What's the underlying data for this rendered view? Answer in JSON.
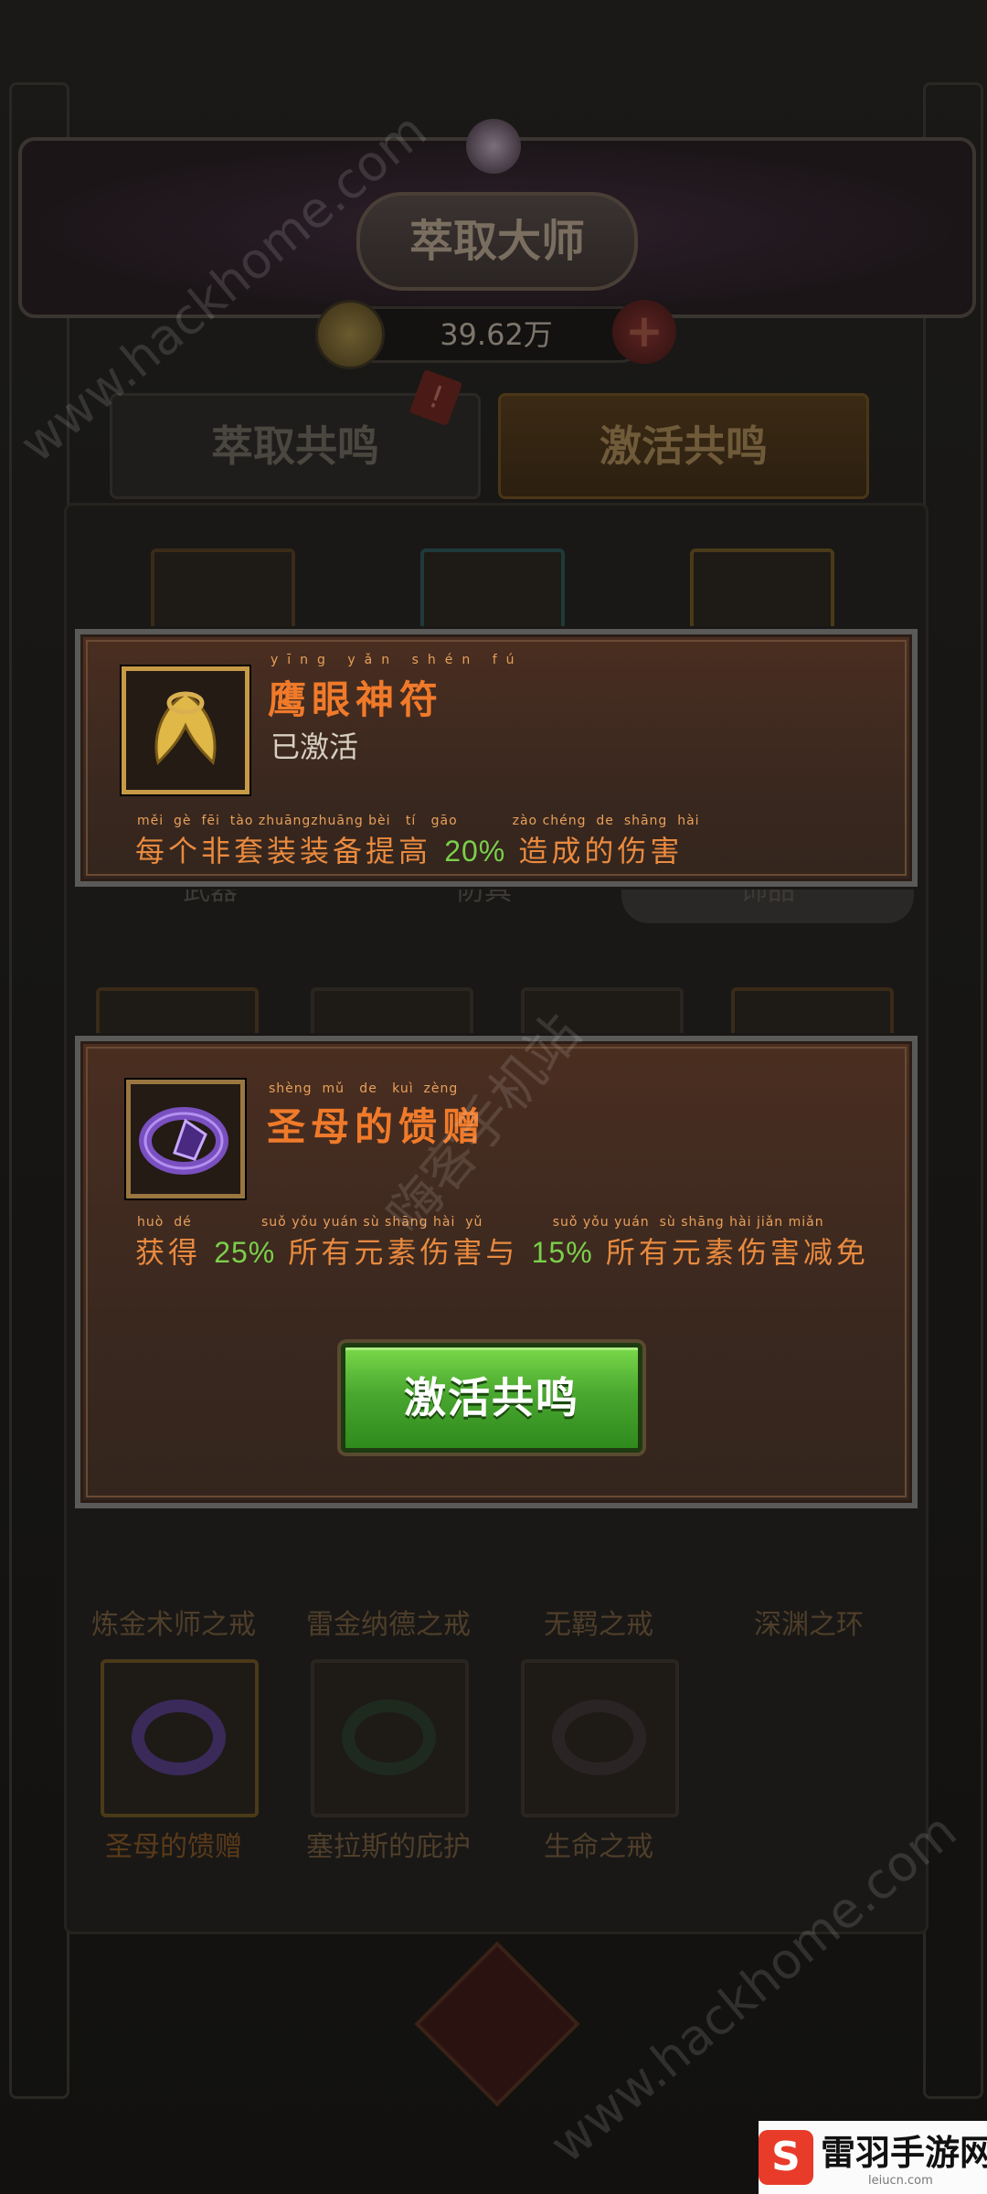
{
  "header": {
    "title": "萃取大师",
    "currency_value": "39.62万"
  },
  "tabs": {
    "extract": "萃取共鸣",
    "activate": "激活共鸣"
  },
  "categories": [
    "武器",
    "防具",
    "饰品"
  ],
  "background_items": {
    "row1": [
      "炼金术师之戒",
      "雷金纳德之戒",
      "无羁之戒",
      "深渊之环"
    ],
    "row2": [
      "圣母的馈赠",
      "塞拉斯的庇护",
      "生命之戒"
    ]
  },
  "tooltip_eagle": {
    "name": "鹰眼神符",
    "name_pinyin": [
      "yīng",
      "yǎn",
      "shén",
      "fú"
    ],
    "status": "已激活",
    "desc_pinyin": "měi  gè  fēi  tào zhuāngzhuāng bèi   tí   gāo           zào chéng  de  shāng  hài",
    "desc_before": "每个非套装装备提高",
    "desc_pct": "20%",
    "desc_after": "造成的伤害"
  },
  "tooltip_ring": {
    "name": "圣母的馈赠",
    "name_pinyin": "shèng  mǔ   de   kuì  zèng",
    "desc_pinyin": "huò  dé              suǒ yǒu yuán sù shāng hài  yǔ              suǒ yǒu yuán  sù shāng hài jiǎn miǎn",
    "desc_1": "获得",
    "pct_1": "25%",
    "desc_2": "所有元素伤害与",
    "pct_2": "15%",
    "desc_3": "所有元素伤害减免",
    "button": "激活共鸣"
  },
  "watermarks": {
    "site_top": "www.hackhome.com",
    "site_bottom": "www.hackhome.com",
    "cn": "嗨客手机站",
    "brand_name": "雷羽手游网",
    "brand_url": "leiucn.com"
  },
  "colors": {
    "title_orange": "#f07a2a",
    "pct_green": "#7ad04a",
    "button_green": "#4aa830",
    "icon_border_gold": "#c79a46"
  }
}
